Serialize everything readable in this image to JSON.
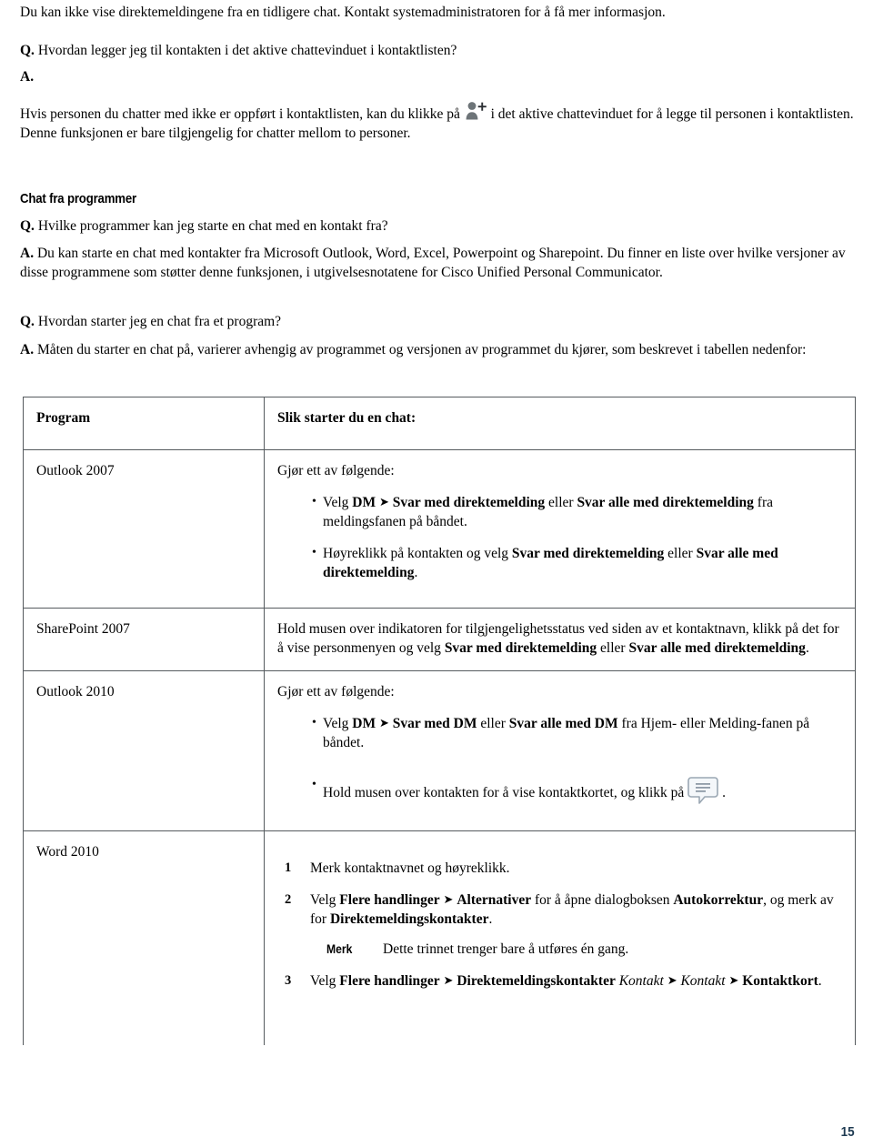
{
  "page": {
    "number": "15",
    "number_color": "#1f3b52"
  },
  "intro": {
    "paragraph": "Du kan ikke vise direktemeldingene fra en tidligere chat. Kontakt systemadministratoren for å få mer informasjon."
  },
  "faq_add_contact": {
    "q_label": "Q.",
    "question": "Hvordan legger jeg til kontakten i det aktive chattevinduet i kontaktlisten?",
    "a_label": "A.",
    "answer_part1": "Hvis personen du chatter med ikke er oppført i kontaktlisten, kan du klikke på",
    "icon_name": "add-contact-icon",
    "answer_part2": "i det aktive chattevinduet for å legge til personen i kontaktlisten. Denne funksjonen er bare tilgjengelig for chatter mellom to personer."
  },
  "section": {
    "heading": "Chat fra programmer"
  },
  "faq_programs": {
    "q_label": "Q.",
    "question": "Hvilke programmer kan jeg starte en chat med en kontakt fra?",
    "a_label": "A.",
    "answer": "Du kan starte en chat med kontakter fra Microsoft Outlook, Word, Excel, Powerpoint og Sharepoint. Du finner en liste over hvilke versjoner av disse programmene som støtter denne funksjonen, i utgivelsesnotatene for Cisco Unified Personal Communicator."
  },
  "faq_start_from_program": {
    "q_label": "Q.",
    "question": "Hvordan starter jeg en chat fra et program?",
    "a_label": "A.",
    "answer": "Måten du starter en chat på, varierer avhengig av programmet og versjonen av programmet du kjører, som beskrevet i tabellen nedenfor:"
  },
  "table": {
    "headers": {
      "program": "Program",
      "how": "Slik starter du en chat:"
    },
    "rows": [
      {
        "program": "Outlook 2007",
        "intro": "Gjør ett av følgende:",
        "bullets": [
          {
            "t1": "Velg ",
            "b1": "DM",
            "arrow": "➤",
            "b2": "Svar med direktemelding",
            "t2": " eller ",
            "b3": "Svar alle med direktemelding",
            "t3": " fra meldingsfanen på båndet."
          },
          {
            "t1": "Høyreklikk på kontakten og velg ",
            "b1": "Svar med direktemelding",
            "t2": " eller ",
            "b2": "Svar alle med direktemelding",
            "t3": "."
          }
        ]
      },
      {
        "program": "SharePoint 2007",
        "body_t1": "Hold musen over indikatoren for tilgjengelighetsstatus ved siden av et kontaktnavn, klikk på det for å vise personmenyen og velg ",
        "body_b1": "Svar med direktemelding",
        "body_t2": " eller ",
        "body_b2": "Svar alle med direktemelding",
        "body_t3": "."
      },
      {
        "program": "Outlook 2010",
        "intro": "Gjør ett av følgende:",
        "bullets": [
          {
            "t1": "Velg ",
            "b1": "DM",
            "arrow": "➤",
            "b2": "Svar med DM",
            "t2": " eller ",
            "b3": "Svar alle med DM",
            "t3": " fra Hjem- eller Melding-fanen på båndet."
          },
          {
            "t1": "Hold musen over kontakten for å vise kontaktkortet, og klikk på",
            "icon_name": "chat-bubble-icon",
            "t2": "."
          }
        ]
      },
      {
        "program": "Word 2010",
        "steps": [
          {
            "text": "Merk kontaktnavnet og høyreklikk."
          },
          {
            "t1": "Velg ",
            "b1": "Flere handlinger",
            "arrow": "➤",
            "b2": "Alternativer",
            "t2": " for å åpne dialogboksen ",
            "b3": "Autokorrektur",
            "t3": ", og merk av for ",
            "b4": "Direktemeldingskontakter",
            "t4": ".",
            "note_label": "Merk",
            "note_text": "Dette trinnet trenger bare å utføres én gang."
          },
          {
            "t1": "Velg ",
            "b1": "Flere handlinger",
            "arrow1": "➤",
            "b2": "Direktemeldingskontakter",
            "i1": "Kontakt",
            "arrow2": "➤",
            "i2": "Kontakt",
            "arrow3": "➤",
            "b3": "Kontaktkort",
            "t2": "."
          }
        ]
      }
    ]
  }
}
